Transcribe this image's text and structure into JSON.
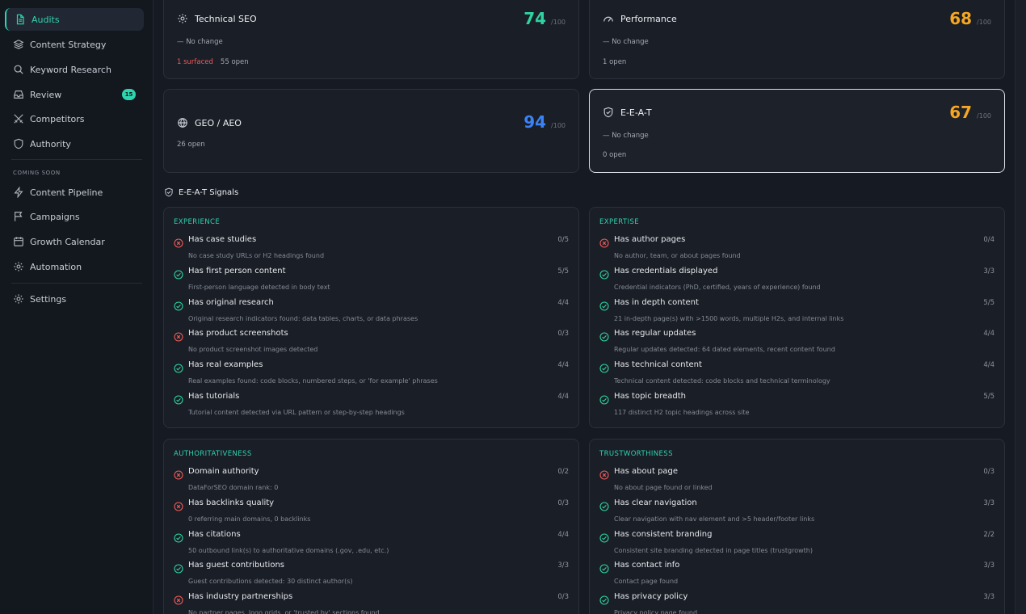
{
  "sidebar": {
    "items": [
      {
        "label": "Audits",
        "icon": "document-icon",
        "active": true
      },
      {
        "label": "Content Strategy",
        "icon": "layers-icon"
      },
      {
        "label": "Keyword Research",
        "icon": "search-icon"
      },
      {
        "label": "Review",
        "icon": "inbox-icon",
        "badge": "15"
      },
      {
        "label": "Competitors",
        "icon": "swords-icon"
      },
      {
        "label": "Authority",
        "icon": "shield-icon"
      }
    ],
    "coming_soon_label": "COMING SOON",
    "soon_items": [
      {
        "label": "Content Pipeline",
        "icon": "lightning-icon"
      },
      {
        "label": "Campaigns",
        "icon": "flag-icon"
      },
      {
        "label": "Growth Calendar",
        "icon": "calendar-icon"
      },
      {
        "label": "Automation",
        "icon": "cog-icon"
      }
    ],
    "settings_label": "Settings"
  },
  "scores": {
    "technical_seo": {
      "title": "Technical SEO",
      "score": "74",
      "max": "/100",
      "change": "— No change",
      "surfaced": "1 surfaced",
      "open": "55 open",
      "color": "#2ed3a0"
    },
    "performance": {
      "title": "Performance",
      "score": "68",
      "max": "/100",
      "change": "— No change",
      "open": "1 open",
      "color": "#f5a623"
    },
    "geo_aeo": {
      "title": "GEO / AEO",
      "score": "94",
      "max": "/100",
      "open": "26 open",
      "color": "#3b82f6"
    },
    "eeat": {
      "title": "E-E-A-T",
      "score": "67",
      "max": "/100",
      "change": "— No change",
      "open": "0 open",
      "color": "#f5a623"
    }
  },
  "signals_title": "E-E-A-T Signals",
  "signals": {
    "experience": {
      "category": "EXPERIENCE",
      "rows": [
        {
          "label": "Has case studies",
          "score": "0/5",
          "detail": "No case study URLs or H2 headings found",
          "pass": false
        },
        {
          "label": "Has first person content",
          "score": "5/5",
          "detail": "First-person language detected in body text",
          "pass": true
        },
        {
          "label": "Has original research",
          "score": "4/4",
          "detail": "Original research indicators found: data tables, charts, or data phrases",
          "pass": true
        },
        {
          "label": "Has product screenshots",
          "score": "0/3",
          "detail": "No product screenshot images detected",
          "pass": false
        },
        {
          "label": "Has real examples",
          "score": "4/4",
          "detail": "Real examples found: code blocks, numbered steps, or 'for example' phrases",
          "pass": true
        },
        {
          "label": "Has tutorials",
          "score": "4/4",
          "detail": "Tutorial content detected via URL pattern or step-by-step headings",
          "pass": true
        }
      ]
    },
    "expertise": {
      "category": "EXPERTISE",
      "rows": [
        {
          "label": "Has author pages",
          "score": "0/4",
          "detail": "No author, team, or about pages found",
          "pass": false
        },
        {
          "label": "Has credentials displayed",
          "score": "3/3",
          "detail": "Credential indicators (PhD, certified, years of experience) found",
          "pass": true
        },
        {
          "label": "Has in depth content",
          "score": "5/5",
          "detail": "21 in-depth page(s) with >1500 words, multiple H2s, and internal links",
          "pass": true
        },
        {
          "label": "Has regular updates",
          "score": "4/4",
          "detail": "Regular updates detected: 64 dated elements, recent content found",
          "pass": true
        },
        {
          "label": "Has technical content",
          "score": "4/4",
          "detail": "Technical content detected: code blocks and technical terminology",
          "pass": true
        },
        {
          "label": "Has topic breadth",
          "score": "5/5",
          "detail": "117 distinct H2 topic headings across site",
          "pass": true
        }
      ]
    },
    "authoritativeness": {
      "category": "AUTHORITATIVENESS",
      "rows": [
        {
          "label": "Domain authority",
          "score": "0/2",
          "detail": "DataForSEO domain rank: 0",
          "pass": false
        },
        {
          "label": "Has backlinks quality",
          "score": "0/3",
          "detail": "0 referring main domains, 0 backlinks",
          "pass": false
        },
        {
          "label": "Has citations",
          "score": "4/4",
          "detail": "50 outbound link(s) to authoritative domains (.gov, .edu, etc.)",
          "pass": true
        },
        {
          "label": "Has guest contributions",
          "score": "3/3",
          "detail": "Guest contributions detected: 30 distinct author(s)",
          "pass": true
        },
        {
          "label": "Has industry partnerships",
          "score": "0/3",
          "detail": "No partner pages, logo grids, or 'trusted by' sections found",
          "pass": false
        }
      ]
    },
    "trustworthiness": {
      "category": "TRUSTWORTHINESS",
      "rows": [
        {
          "label": "Has about page",
          "score": "0/3",
          "detail": "No about page found or linked",
          "pass": false
        },
        {
          "label": "Has clear navigation",
          "score": "3/3",
          "detail": "Clear navigation with nav element and >5 header/footer links",
          "pass": true
        },
        {
          "label": "Has consistent branding",
          "score": "2/2",
          "detail": "Consistent site branding detected in page titles (trustgrowth)",
          "pass": true
        },
        {
          "label": "Has contact info",
          "score": "3/3",
          "detail": "Contact page found",
          "pass": true
        },
        {
          "label": "Has privacy policy",
          "score": "3/3",
          "detail": "Privacy policy page found",
          "pass": true
        }
      ]
    }
  }
}
